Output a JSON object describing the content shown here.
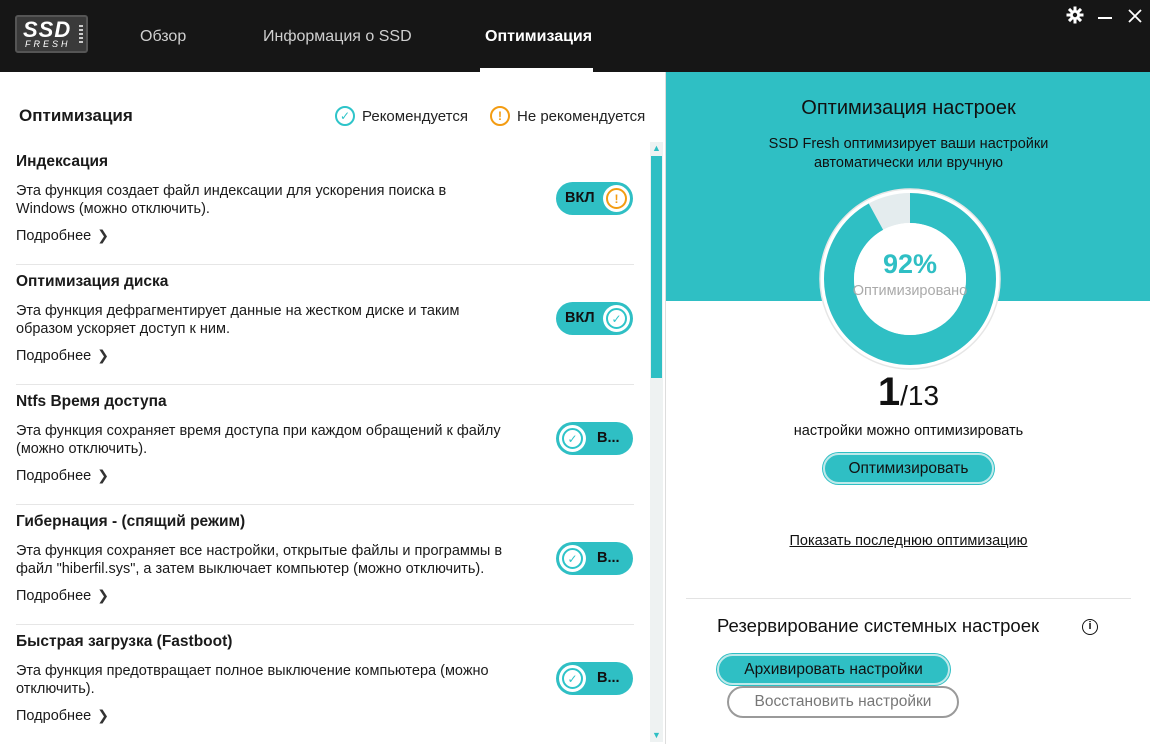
{
  "header": {
    "logo_top": "SSD",
    "logo_bottom": "FRESH",
    "tabs": [
      {
        "label": "Обзор",
        "active": false
      },
      {
        "label": "Информация о SSD",
        "active": false
      },
      {
        "label": "Оптимизация",
        "active": true
      }
    ],
    "controls": {
      "settings": "gear-icon",
      "minimize": "minimize-icon",
      "close": "close-icon"
    }
  },
  "left": {
    "title": "Оптимизация",
    "legend": {
      "recommended": "Рекомендуется",
      "not_recommended": "Не рекомендуется"
    },
    "more_label": "Подробнее",
    "items": [
      {
        "title": "Индексация",
        "desc_1": "Эта функция создает файл индексации для ускорения поиска в",
        "desc_2": "Windows (можно отключить).",
        "toggle": "ВКЛ",
        "state": "on",
        "status": "not-recommended"
      },
      {
        "title": "Оптимизация диска",
        "desc_1": "Эта функция дефрагментирует данные на жестком диске и таким",
        "desc_2": "образом ускоряет доступ к ним.",
        "toggle": "ВКЛ",
        "state": "on",
        "status": "recommended"
      },
      {
        "title": "Ntfs Время доступа",
        "desc_1": "Эта функция сохраняет время доступа при каждом обращений к файлу",
        "desc_2": "(можно отключить).",
        "toggle": "В...",
        "state": "off",
        "status": "recommended"
      },
      {
        "title": "Гибернация - (спящий режим)",
        "desc_1": "Эта функция сохраняет все настройки, открытые файлы и программы в",
        "desc_2": "файл \"hiberfil.sys\", а затем выключает компьютер (можно отключить).",
        "toggle": "В...",
        "state": "off",
        "status": "recommended"
      },
      {
        "title": "Быстрая загрузка (Fastboot)",
        "desc_1": "Эта функция предотвращает полное выключение компьютера (можно",
        "desc_2": "отключить).",
        "toggle": "В...",
        "state": "off",
        "status": "recommended"
      }
    ]
  },
  "right": {
    "title": "Оптимизация настроек",
    "subtitle_1": "SSD Fresh оптимизирует ваши настройки",
    "subtitle_2": "автоматически или вручную",
    "gauge_percent": 92,
    "gauge_label_pct": "92%",
    "gauge_label": "Оптимизировано",
    "count_current": "1",
    "count_total": "/13",
    "count_label": "настройки можно оптимизировать",
    "optimize_button": "Оптимизировать",
    "last_link": "Показать последнюю оптимизацию",
    "backup_title": "Резервирование системных настроек",
    "archive_button": "Архивировать настройки",
    "restore_button": "Восстановить настройки"
  },
  "colors": {
    "accent": "#2fbfc4",
    "warning": "#f39c12",
    "header_bg": "#161616"
  }
}
